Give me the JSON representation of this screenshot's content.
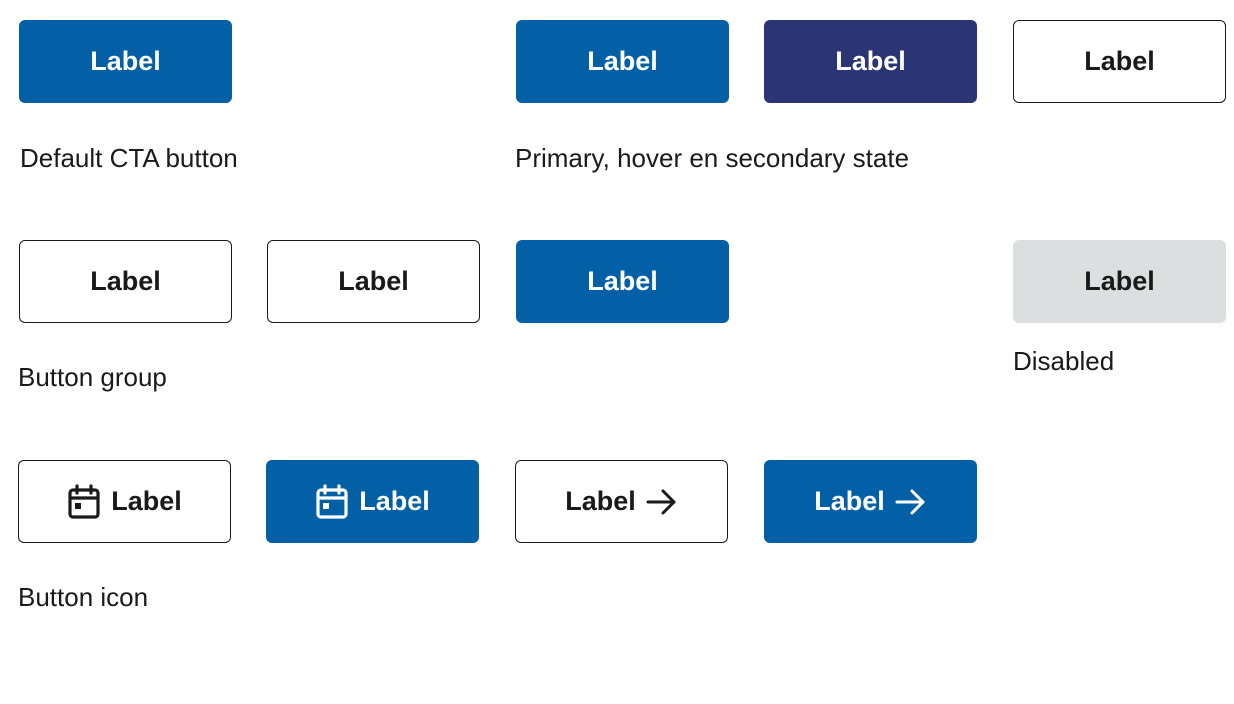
{
  "colors": {
    "primary": "#0460a6",
    "hover": "#2b3474",
    "secondary_border": "#1a1a1a",
    "disabled_bg": "#dcdfe0",
    "text": "#1a1a1a"
  },
  "section_default": {
    "button_label": "Label",
    "caption": "Default CTA button"
  },
  "section_states": {
    "primary_label": "Label",
    "hover_label": "Label",
    "secondary_label": "Label",
    "caption": "Primary, hover en secondary state"
  },
  "section_group": {
    "button_1_label": "Label",
    "button_2_label": "Label",
    "button_3_label": "Label",
    "caption": "Button group"
  },
  "section_disabled": {
    "button_label": "Label",
    "caption": "Disabled"
  },
  "section_icon": {
    "button_1": {
      "label": "Label",
      "icon": "calendar-icon"
    },
    "button_2": {
      "label": "Label",
      "icon": "calendar-icon"
    },
    "button_3": {
      "label": "Label",
      "icon": "arrow-right-icon"
    },
    "button_4": {
      "label": "Label",
      "icon": "arrow-right-icon"
    },
    "caption": "Button icon"
  }
}
